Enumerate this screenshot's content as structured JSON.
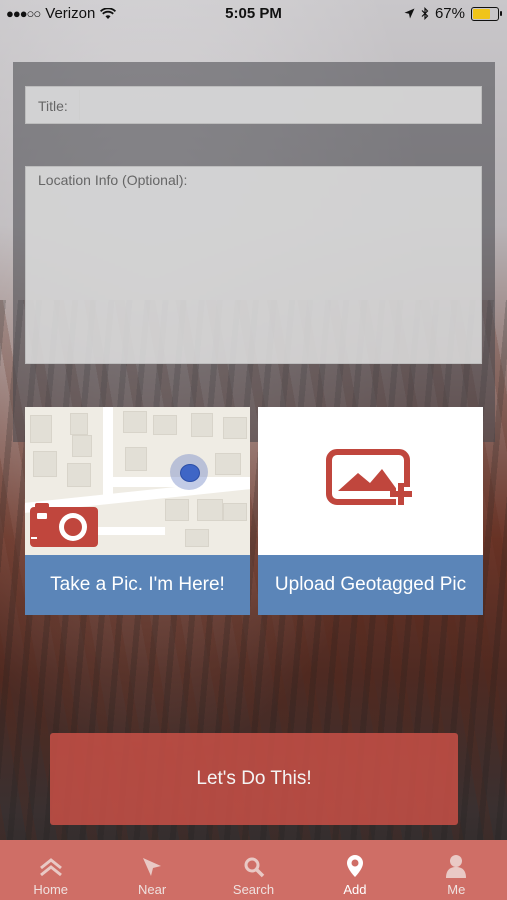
{
  "status_bar": {
    "signal": "●●●○○",
    "carrier": "Verizon",
    "time": "5:05 PM",
    "battery_pct": "67%",
    "battery_level": 0.67
  },
  "form": {
    "title_label": "Title:",
    "location_label": "Location Info (Optional):"
  },
  "cards": {
    "take_pic": "Take a Pic. I'm Here!",
    "upload": "Upload Geotagged Pic"
  },
  "cta": {
    "label": "Let's Do This!"
  },
  "tabs": [
    {
      "label": "Home",
      "icon": "home-icon"
    },
    {
      "label": "Near",
      "icon": "location-arrow-icon"
    },
    {
      "label": "Search",
      "icon": "search-icon"
    },
    {
      "label": "Add",
      "icon": "map-pin-icon",
      "active": true
    },
    {
      "label": "Me",
      "icon": "user-icon"
    }
  ],
  "colors": {
    "accent_red": "#c85046",
    "card_blue": "#5b85b8",
    "tab_bar": "#cf6e66"
  }
}
